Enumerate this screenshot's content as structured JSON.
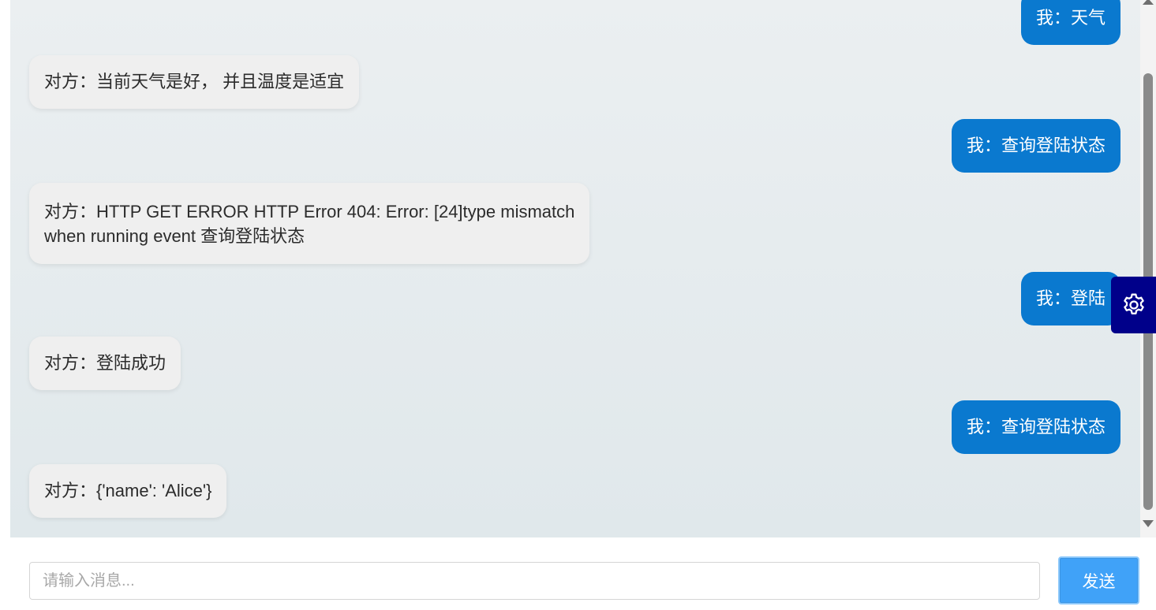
{
  "messages": [
    {
      "from": "me",
      "text": "我：天气"
    },
    {
      "from": "other",
      "text": "对方：当前天气是好， 并且温度是适宜"
    },
    {
      "from": "me",
      "text": "我：查询登陆状态"
    },
    {
      "from": "other",
      "line1": "对方：HTTP GET ERROR HTTP Error 404: Error: [24]type mismatch",
      "line2": "when running event 查询登陆状态"
    },
    {
      "from": "me",
      "text": "我：登陆"
    },
    {
      "from": "other",
      "text": "对方：登陆成功"
    },
    {
      "from": "me",
      "text": "我：查询登陆状态"
    },
    {
      "from": "other",
      "text": "对方：{'name': 'Alice'}"
    }
  ],
  "input": {
    "placeholder": "请输入消息...",
    "value": ""
  },
  "send_label": "发送",
  "icons": {
    "settings": "gear-icon"
  },
  "colors": {
    "my_bubble": "#0a79cf",
    "other_bubble": "#efefef",
    "settings_bg": "#00008a",
    "send_bg": "#40a2f8"
  }
}
